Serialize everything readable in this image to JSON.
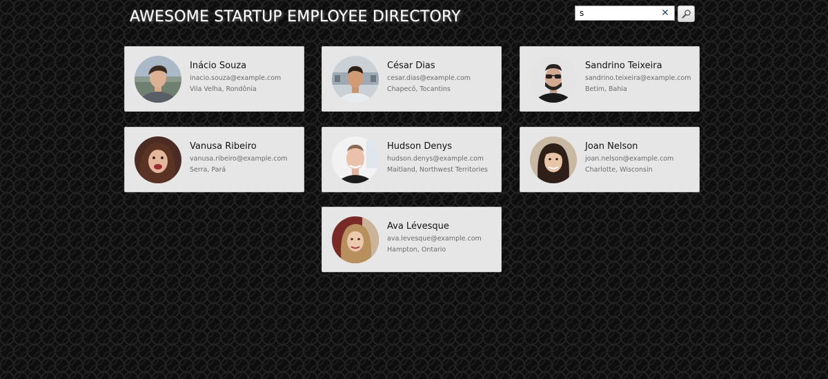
{
  "header": {
    "title": "AWESOME STARTUP EMPLOYEE DIRECTORY"
  },
  "search": {
    "value": "s",
    "placeholder": "Search...",
    "clear_icon": "close-icon",
    "button_icon": "search-icon"
  },
  "employees": [
    {
      "name": "Inácio Souza",
      "email": "inacio.souza@example.com",
      "location": "Vila Velha, Rondônia"
    },
    {
      "name": "César Dias",
      "email": "cesar.dias@example.com",
      "location": "Chapecó, Tocantins"
    },
    {
      "name": "Sandrino Teixeira",
      "email": "sandrino.teixeira@example.com",
      "location": "Betim, Bahia"
    },
    {
      "name": "Vanusa Ribeiro",
      "email": "vanusa.ribeiro@example.com",
      "location": "Serra, Pará"
    },
    {
      "name": "Hudson Denys",
      "email": "hudson.denys@example.com",
      "location": "Maitland, Northwest Territories"
    },
    {
      "name": "Joan Nelson",
      "email": "joan.nelson@example.com",
      "location": "Charlotte, Wisconsin"
    },
    {
      "name": "Ava Lévesque",
      "email": "ava.levesque@example.com",
      "location": "Hampton, Ontario"
    }
  ],
  "colors": {
    "background": "#0e0e0e",
    "card": "#e6e6e6",
    "title": "#ffffff"
  }
}
